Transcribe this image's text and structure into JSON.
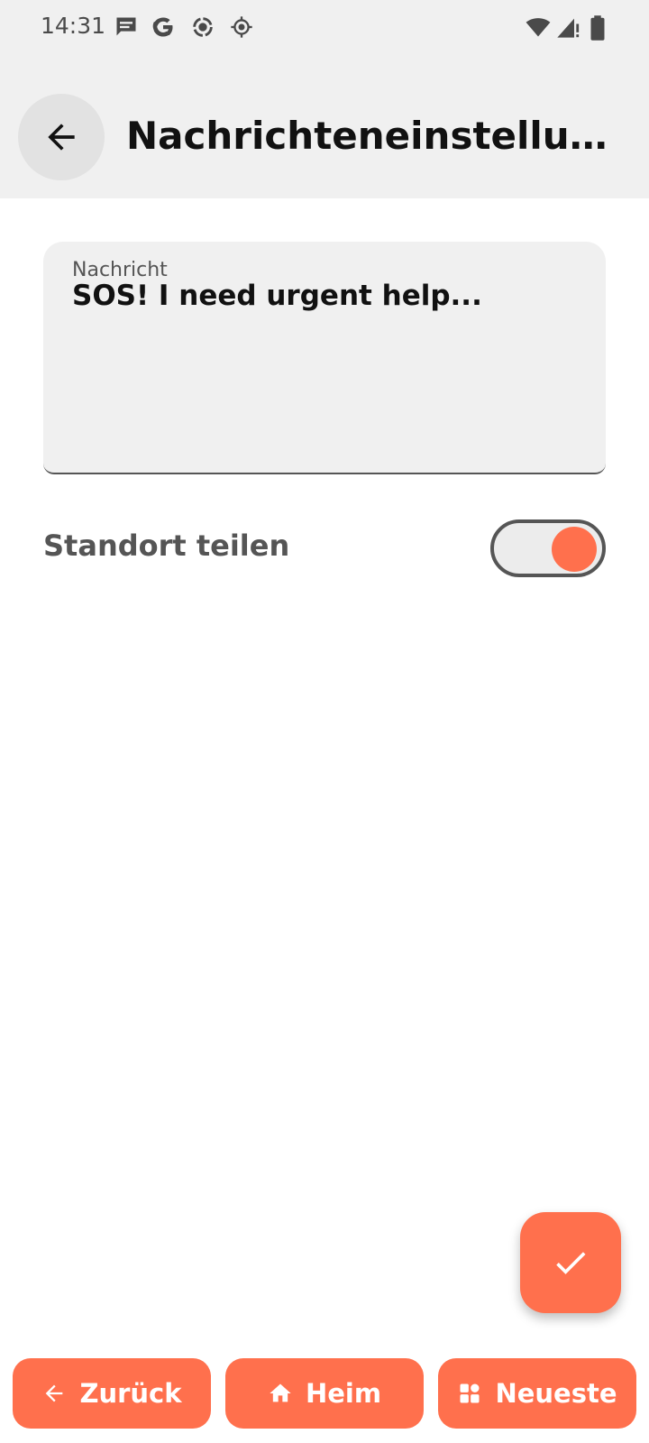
{
  "status_bar": {
    "time": "14:31",
    "icons": [
      "message-icon",
      "google-icon",
      "screen-record-icon",
      "location-icon",
      "wifi-icon",
      "signal-icon",
      "battery-icon"
    ]
  },
  "app_bar": {
    "title": "Nachrichteneinstellungen",
    "back_icon": "arrow-back-icon"
  },
  "message_field": {
    "label": "Nachricht",
    "value": "SOS! I need urgent help..."
  },
  "location_setting": {
    "label": "Standort teilen",
    "enabled": true
  },
  "fab": {
    "icon": "check-icon"
  },
  "bottom_nav": {
    "back_label": "Zurück",
    "home_label": "Heim",
    "latest_label": "Neueste"
  },
  "colors": {
    "accent": "#ff704d",
    "app_bar_bg": "#f0f0f0",
    "field_bg": "#f0f0f0",
    "text_primary": "#111111",
    "text_secondary": "#555555"
  }
}
